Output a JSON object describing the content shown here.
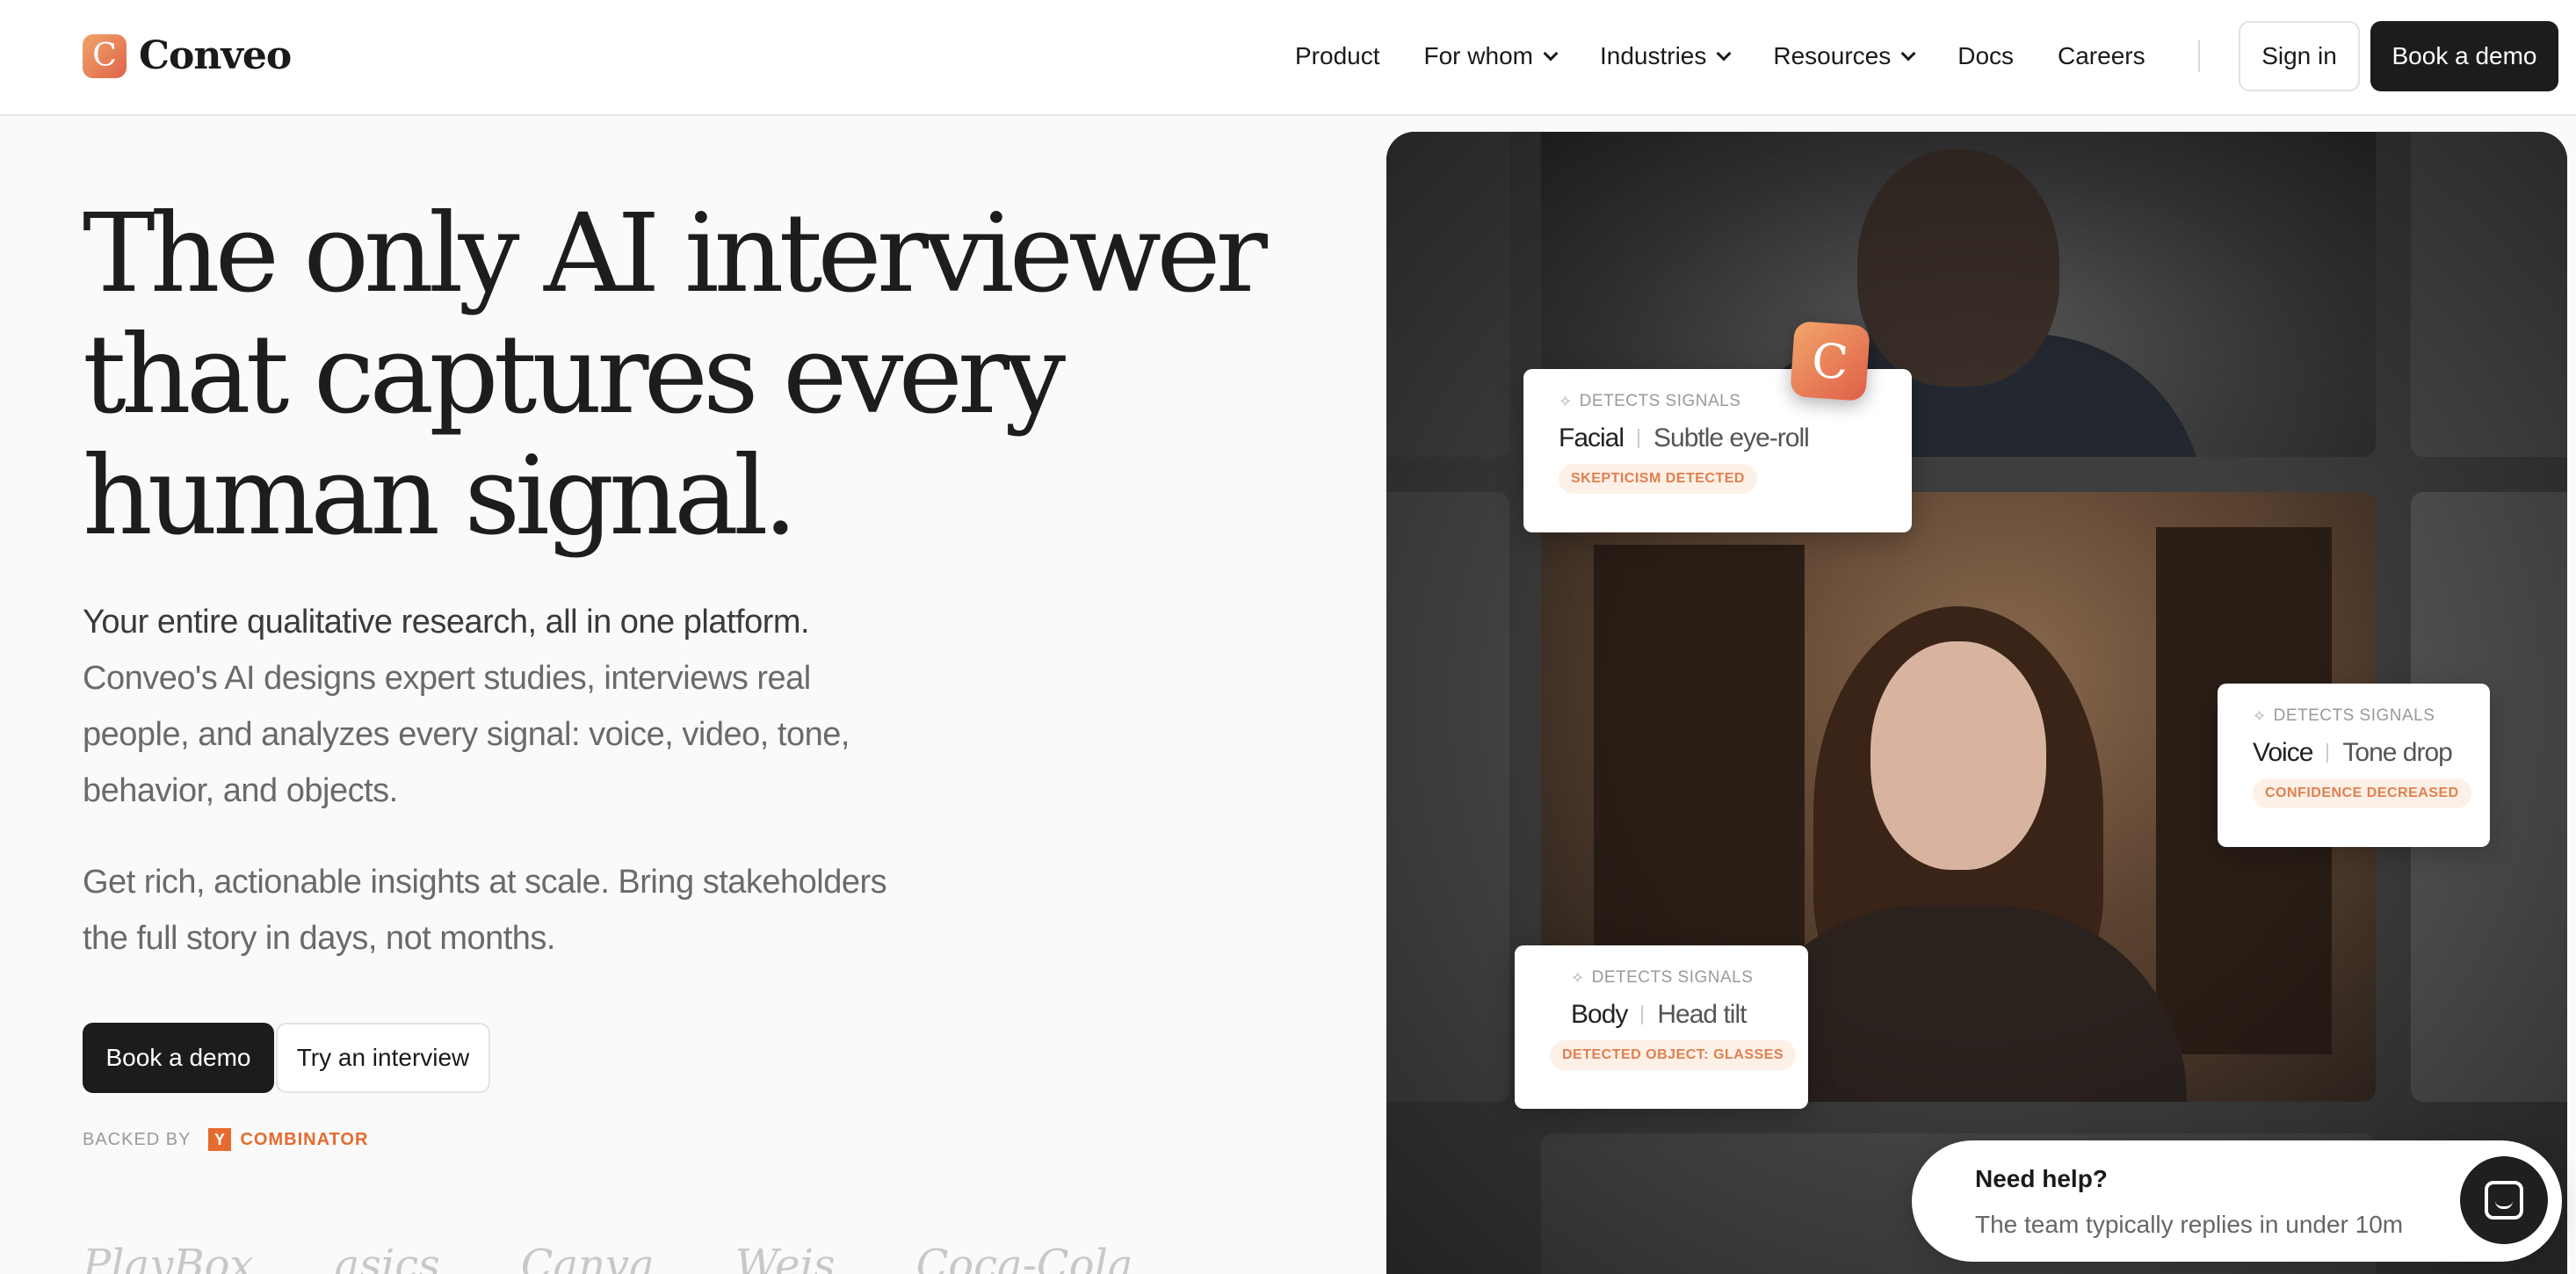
{
  "brand": {
    "logo_letter": "C",
    "name": "Conveo"
  },
  "nav": {
    "items": [
      {
        "label": "Product",
        "dropdown": false
      },
      {
        "label": "For whom",
        "dropdown": true
      },
      {
        "label": "Industries",
        "dropdown": true
      },
      {
        "label": "Resources",
        "dropdown": true
      },
      {
        "label": "Docs",
        "dropdown": false
      },
      {
        "label": "Careers",
        "dropdown": false
      }
    ],
    "sign_in": "Sign in",
    "book_demo": "Book a demo"
  },
  "hero": {
    "title_lines": [
      "The only AI interviewer",
      "that captures every",
      "human signal."
    ],
    "lead": "Your entire qualitative research, all in one platform.",
    "body": "Conveo's AI designs expert studies, interviews real people, and analyzes every signal: voice, video, tone, behavior, and objects.",
    "secondary": "Get rich, actionable insights at scale. Bring stakeholders the full story in days, not months.",
    "cta_primary": "Book a demo",
    "cta_secondary": "Try an interview",
    "backed_label": "BACKED BY",
    "backer_letter": "Y",
    "backer_name": "COMBINATOR",
    "customer_logos": [
      "PlayBox",
      "asics",
      "Canva",
      "Weis",
      "Coca-Cola"
    ]
  },
  "signals": {
    "badge_letter": "C",
    "cards": [
      {
        "label": "DETECTS SIGNALS",
        "kind": "Facial",
        "detail": "Subtle eye-roll",
        "tag": "SKEPTICISM DETECTED"
      },
      {
        "label": "DETECTS SIGNALS",
        "kind": "Voice",
        "detail": "Tone drop",
        "tag": "CONFIDENCE DECREASED"
      },
      {
        "label": "DETECTS SIGNALS",
        "kind": "Body",
        "detail": "Head tilt",
        "tag": "DETECTED OBJECT: GLASSES"
      }
    ]
  },
  "help_widget": {
    "title": "Need help?",
    "subtitle": "The team typically replies in under 10m"
  },
  "colors": {
    "accent": "#e56b2f",
    "dark_button": "#1c1c1c",
    "tag_bg": "#fdf0e6",
    "tag_text": "#e08050"
  }
}
